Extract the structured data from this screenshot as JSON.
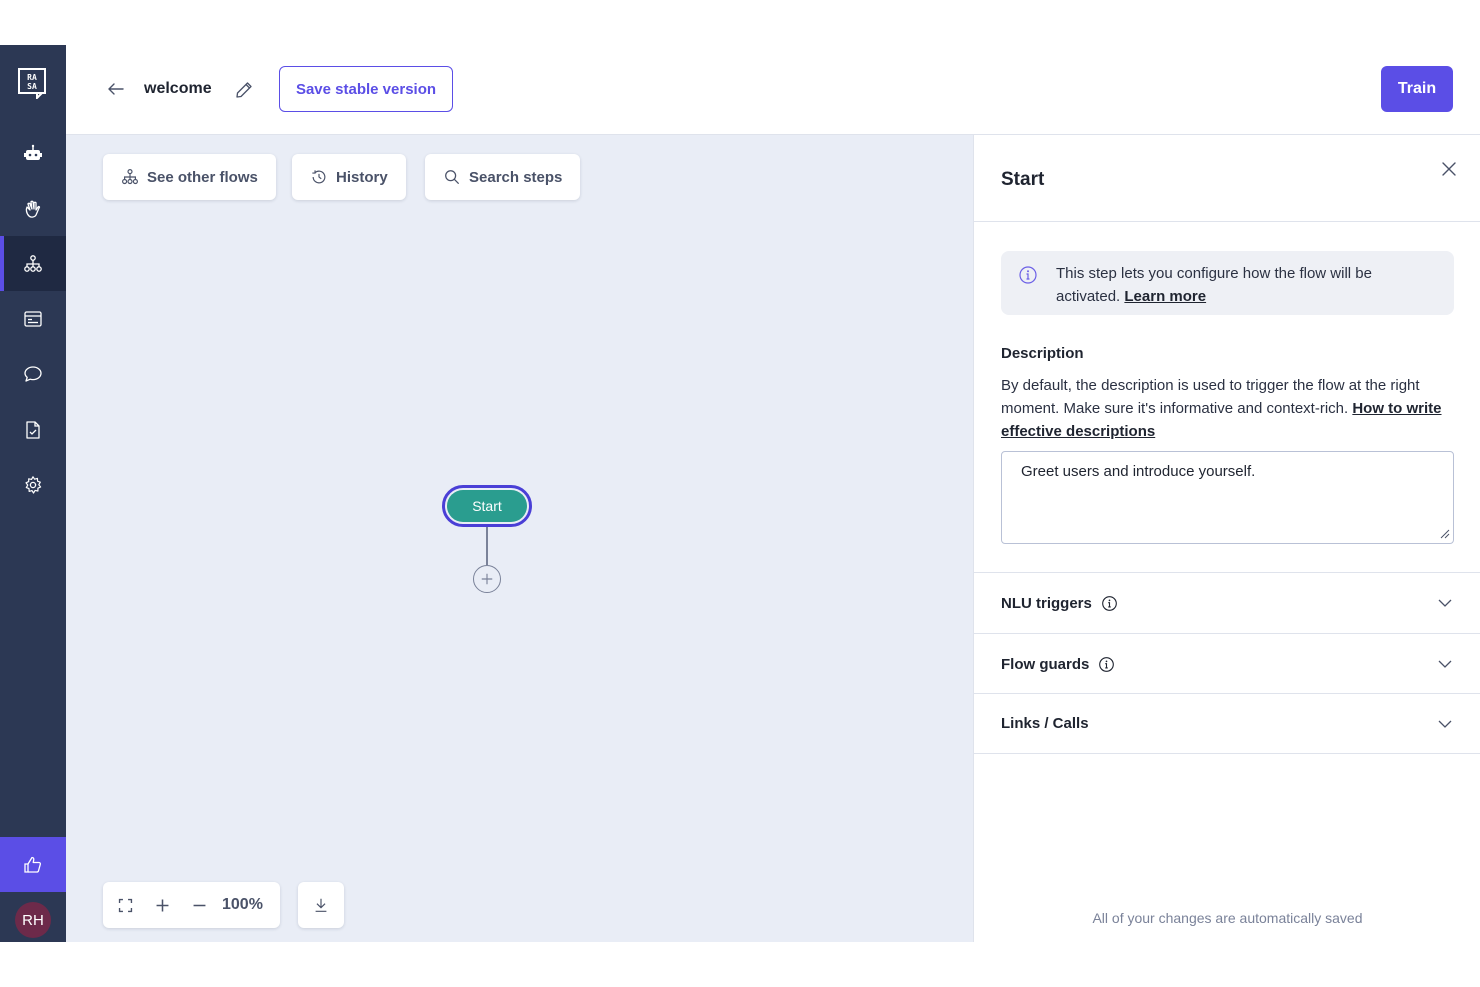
{
  "header": {
    "flow_name": "welcome",
    "save_label": "Save stable version",
    "train_label": "Train"
  },
  "sidebar": {
    "items": [
      {
        "icon": "robot-icon"
      },
      {
        "icon": "hand-wave-icon"
      },
      {
        "icon": "flows-icon",
        "active": true
      },
      {
        "icon": "responses-icon"
      },
      {
        "icon": "chat-icon"
      },
      {
        "icon": "document-check-icon"
      },
      {
        "icon": "gear-icon"
      }
    ],
    "feedback_icon": "thumbs-up-icon",
    "avatar_initials": "RH"
  },
  "toolbar": {
    "see_other_flows": "See other flows",
    "history": "History",
    "search_steps": "Search steps"
  },
  "canvas": {
    "start_node_label": "Start",
    "zoom_level": "100%"
  },
  "panel": {
    "title": "Start",
    "info_text": "This step lets you configure how the flow will be activated.",
    "info_link": "Learn more",
    "description_label": "Description",
    "description_help": "By default, the description is used to trigger the flow at the right moment. Make sure it's informative and context-rich.",
    "description_help_link": "How to write effective descriptions",
    "description_value": "Greet users and introduce yourself.",
    "sections": [
      {
        "label": "NLU triggers",
        "has_info": true
      },
      {
        "label": "Flow guards",
        "has_info": true
      },
      {
        "label": "Links / Calls",
        "has_info": false
      }
    ],
    "footer_note": "All of your changes are automatically saved"
  },
  "colors": {
    "accent": "#5b4ee6",
    "sidebar_bg": "#2c3854",
    "canvas_bg": "#e9edf6",
    "start_node": "#2a9d8f"
  }
}
